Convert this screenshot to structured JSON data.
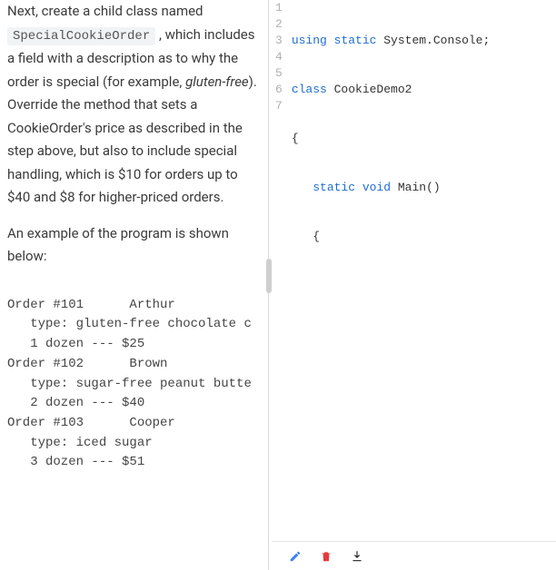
{
  "description": {
    "para1_prefix": "Next, create a child class named ",
    "code_chip": "SpecialCookieOrder",
    "para1_mid": " , which includes a field with a description as to why the order is special (for example, ",
    "italic_word": "gluten-free",
    "para1_suffix": "). Override the method that sets a CookieOrder's price as described in the step above, but also to include special handling, which is $10 for orders up to $40 and $8 for higher-priced orders.",
    "para2": "An example of the program is shown below:"
  },
  "example_output": "Order #101      Arthur\n   type: gluten-free chocolate c\n   1 dozen --- $25\nOrder #102      Brown\n   type: sugar-free peanut butte\n   2 dozen --- $40\nOrder #103      Cooper\n   type: iced sugar\n   3 dozen --- $51",
  "editor": {
    "gutter": [
      "1",
      "2",
      "3",
      "4",
      "5",
      "6",
      "7"
    ],
    "line1_kw1": "using",
    "line1_kw2": "static",
    "line1_rest": " System.Console;",
    "line2_kw": "class",
    "line2_name": " CookieDemo2",
    "line3": "{",
    "line4_indent": "   ",
    "line4_kw1": "static",
    "line4_kw2": " void",
    "line4_name": " Main",
    "line4_paren": "()",
    "line5": "   {",
    "line6": "",
    "line7": ""
  },
  "icons": {
    "edit_color": "#3b82f6",
    "trash_color": "#e23c3c",
    "download_color": "#222222"
  }
}
